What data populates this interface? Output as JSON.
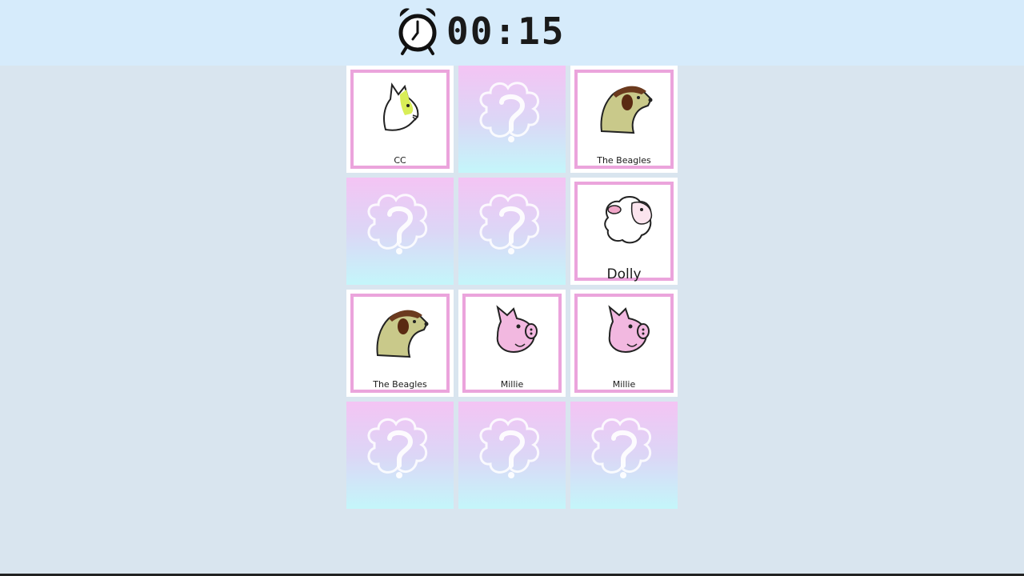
{
  "timer": {
    "display": "00:15"
  },
  "cards": [
    {
      "state": "face-up",
      "animal": "cat",
      "label": "CC"
    },
    {
      "state": "face-down"
    },
    {
      "state": "face-up",
      "animal": "dog",
      "label": "The Beagles"
    },
    {
      "state": "face-down"
    },
    {
      "state": "face-down"
    },
    {
      "state": "face-up",
      "animal": "sheep",
      "label": "Dolly"
    },
    {
      "state": "face-up",
      "animal": "dog",
      "label": "The Beagles"
    },
    {
      "state": "face-up",
      "animal": "pig",
      "label": "Millie"
    },
    {
      "state": "face-up",
      "animal": "pig",
      "label": "Millie"
    },
    {
      "state": "face-down"
    },
    {
      "state": "face-down"
    },
    {
      "state": "face-down"
    }
  ],
  "colors": {
    "card_frame": "#eba4dc",
    "card_back_top": "#f4c4f4",
    "card_back_bottom": "#c4f6fa",
    "topbar": "#d6ebfb",
    "background": "#d9e5ef"
  }
}
